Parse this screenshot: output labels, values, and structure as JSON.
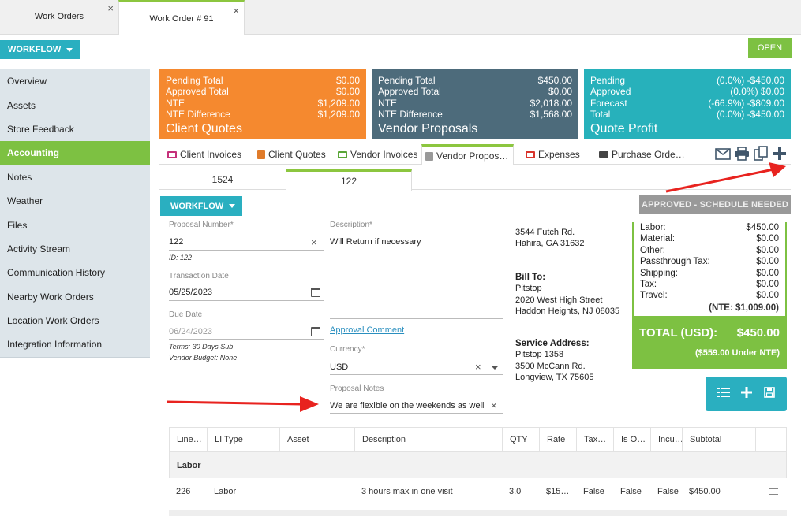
{
  "tabs": [
    {
      "label": "Work Orders"
    },
    {
      "label": "Work Order # 91"
    }
  ],
  "close_glyph": "×",
  "workflow_label": "WORKFLOW",
  "open_label": "OPEN",
  "sidebar": {
    "items": [
      {
        "label": "Overview"
      },
      {
        "label": "Assets"
      },
      {
        "label": "Store Feedback"
      },
      {
        "label": "Accounting"
      },
      {
        "label": "Notes"
      },
      {
        "label": "Weather"
      },
      {
        "label": "Files"
      },
      {
        "label": "Activity Stream"
      },
      {
        "label": "Communication History"
      },
      {
        "label": "Nearby Work Orders"
      },
      {
        "label": "Location Work Orders"
      },
      {
        "label": "Integration Information"
      }
    ],
    "active_index": 3
  },
  "cards": {
    "client_quotes": {
      "rows": [
        {
          "label": "Pending Total",
          "value": "$0.00"
        },
        {
          "label": "Approved Total",
          "value": "$0.00"
        },
        {
          "label": "NTE",
          "value": "$1,209.00"
        },
        {
          "label": "NTE Difference",
          "value": "$1,209.00"
        }
      ],
      "title": "Client Quotes",
      "color": "#f5892f"
    },
    "vendor_proposals": {
      "rows": [
        {
          "label": "Pending Total",
          "value": "$450.00"
        },
        {
          "label": "Approved Total",
          "value": "$0.00"
        },
        {
          "label": "NTE",
          "value": "$2,018.00"
        },
        {
          "label": "NTE Difference",
          "value": "$1,568.00"
        }
      ],
      "title": "Vendor Proposals",
      "color": "#4d6b7b"
    },
    "quote_profit": {
      "rows": [
        {
          "label": "Pending",
          "value": "(0.0%) -$450.00"
        },
        {
          "label": "Approved",
          "value": "(0.0%) $0.00"
        },
        {
          "label": "Forecast",
          "value": "(-66.9%) -$809.00"
        },
        {
          "label": "Total",
          "value": "(0.0%) -$450.00"
        }
      ],
      "title": "Quote Profit",
      "color": "#27b1bb"
    }
  },
  "subtabs": [
    {
      "label": "Client Invoices",
      "icon": "invoice-icon"
    },
    {
      "label": "Client Quotes",
      "icon": "quote-icon"
    },
    {
      "label": "Vendor Invoices",
      "icon": "vendor-invoice-icon"
    },
    {
      "label": "Vendor Propos…",
      "icon": "proposal-icon"
    },
    {
      "label": "Expenses",
      "icon": "expense-icon"
    },
    {
      "label": "Purchase Orde…",
      "icon": "truck-icon"
    }
  ],
  "toolbar_icons": [
    "email-icon",
    "print-icon",
    "copy-icon",
    "add-icon"
  ],
  "proposal_tabs": [
    {
      "label": "1524"
    },
    {
      "label": "122"
    }
  ],
  "status_label": "APPROVED - SCHEDULE NEEDED",
  "form": {
    "proposal_number_label": "Proposal Number*",
    "proposal_number_value": "122",
    "id_text": "ID: 122",
    "transaction_date_label": "Transaction Date",
    "transaction_date_value": "05/25/2023",
    "due_date_label": "Due Date",
    "due_date_value": "06/24/2023",
    "terms_text": "Terms: 30 Days Sub",
    "vendor_budget_text": "Vendor Budget: None",
    "description_label": "Description*",
    "description_value": "Will Return if necessary",
    "approval_comment_link": "Approval Comment",
    "currency_label": "Currency*",
    "currency_value": "USD",
    "proposal_notes_label": "Proposal Notes",
    "proposal_notes_value": "We are flexible on the weekends as well"
  },
  "addresses": {
    "vendor_lines": [
      "3544 Futch Rd.",
      "Hahira, GA 31632"
    ],
    "bill_to_heading": "Bill To:",
    "bill_to_lines": [
      "Pitstop",
      "2020 West High Street",
      "Haddon Heights, NJ 08035"
    ],
    "service_heading": "Service Address:",
    "service_lines": [
      "Pitstop 1358",
      "3500 McCann Rd.",
      "Longview, TX 75605"
    ]
  },
  "totals": {
    "rows": [
      {
        "label": "Labor:",
        "value": "$450.00"
      },
      {
        "label": "Material:",
        "value": "$0.00"
      },
      {
        "label": "Other:",
        "value": "$0.00"
      },
      {
        "label": "Passthrough Tax:",
        "value": "$0.00"
      },
      {
        "label": "Shipping:",
        "value": "$0.00"
      },
      {
        "label": "Tax:",
        "value": "$0.00"
      },
      {
        "label": "Travel:",
        "value": "$0.00"
      }
    ],
    "nte_text": "(NTE: $1,009.00)",
    "total_label": "TOTAL (USD):",
    "total_value": "$450.00",
    "under_text": "($559.00 Under NTE)"
  },
  "action_icons": [
    "list-icon",
    "plus-icon",
    "save-icon"
  ],
  "grid": {
    "columns": [
      "Line…",
      "LI Type",
      "Asset",
      "Description",
      "QTY",
      "Rate",
      "Tax…",
      "Is O…",
      "Incu…",
      "Subtotal"
    ],
    "group_label": "Labor",
    "rows": [
      [
        "226",
        "Labor",
        "",
        "3 hours max in one visit",
        "3.0",
        "$15…",
        "False",
        "False",
        "False",
        "$450.00"
      ]
    ]
  }
}
